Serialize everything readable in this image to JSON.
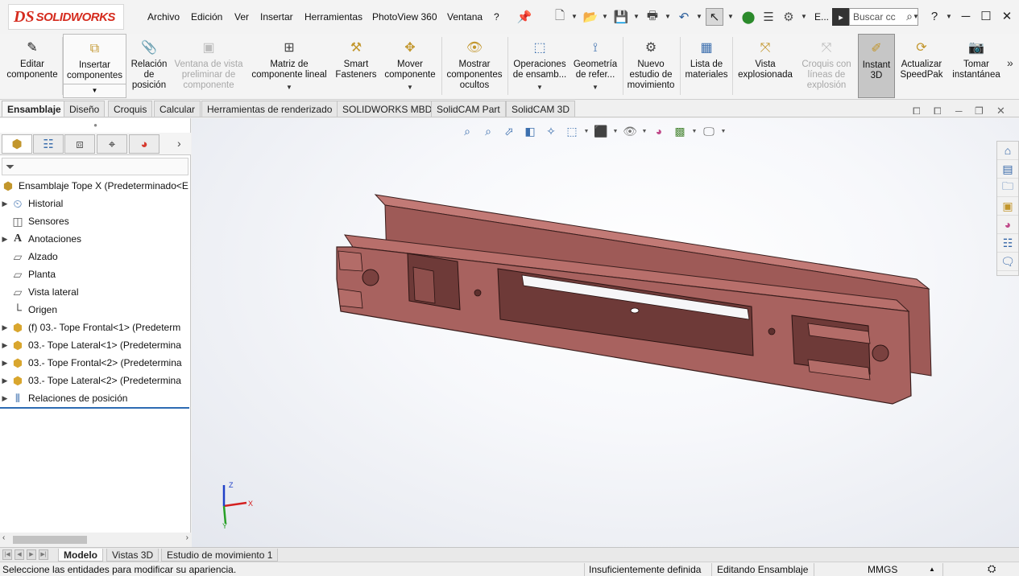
{
  "app": {
    "logo_ds": "DS",
    "logo_text": "SOLIDWORKS",
    "search_placeholder": "Buscar cc",
    "toolbar_more": "E..."
  },
  "menu": [
    "Archivo",
    "Edición",
    "Ver",
    "Insertar",
    "Herramientas",
    "PhotoView 360",
    "Ventana",
    "?"
  ],
  "commands": [
    {
      "label": "Editar\ncomponente",
      "icon": "edit-component-icon",
      "enabled": false
    },
    {
      "label": "Insertar\ncomponentes",
      "icon": "insert-components-icon",
      "enabled": true
    },
    {
      "label": "Relación\nde\nposición",
      "icon": "mate-icon",
      "enabled": true
    },
    {
      "label": "Ventana de vista\npreliminar de\ncomponente",
      "icon": "preview-window-icon",
      "enabled": false
    },
    {
      "label": "Matriz de\ncomponente lineal",
      "icon": "linear-pattern-icon",
      "enabled": true
    },
    {
      "label": "Smart\nFasteners",
      "icon": "smart-fasteners-icon",
      "enabled": true
    },
    {
      "label": "Mover\ncomponente",
      "icon": "move-component-icon",
      "enabled": true
    },
    {
      "label": "Mostrar\ncomponentes\nocultos",
      "icon": "show-hidden-icon",
      "enabled": true
    },
    {
      "label": "Operaciones\nde ensamb...",
      "icon": "assembly-features-icon",
      "enabled": true
    },
    {
      "label": "Geometría\nde refer...",
      "icon": "reference-geometry-icon",
      "enabled": true
    },
    {
      "label": "Nuevo\nestudio de\nmovimiento",
      "icon": "motion-study-icon",
      "enabled": true
    },
    {
      "label": "Lista de\nmateriales",
      "icon": "bom-icon",
      "enabled": true
    },
    {
      "label": "Vista\nexplosionada",
      "icon": "exploded-view-icon",
      "enabled": true
    },
    {
      "label": "Croquis con\nlíneas de\nexplosión",
      "icon": "explode-line-sketch-icon",
      "enabled": false
    },
    {
      "label": "Instant\n3D",
      "icon": "instant3d-icon",
      "enabled": true
    },
    {
      "label": "Actualizar\nSpeedPak",
      "icon": "speedpak-icon",
      "enabled": true
    },
    {
      "label": "Tomar\ninstantánea",
      "icon": "snapshot-icon",
      "enabled": true
    }
  ],
  "tabs": [
    "Ensamblaje",
    "Diseño",
    "Croquis",
    "Calcular",
    "Herramientas de renderizado",
    "SOLIDWORKS MBD",
    "SolidCAM Part",
    "SolidCAM 3D"
  ],
  "tree": [
    {
      "label": "Ensamblaje Tope X  (Predeterminado<E",
      "icon": "assembly-icon",
      "arrow": ""
    },
    {
      "label": "Historial",
      "icon": "history-icon",
      "arrow": "▶"
    },
    {
      "label": "Sensores",
      "icon": "sensors-icon",
      "arrow": ""
    },
    {
      "label": "Anotaciones",
      "icon": "annotations-icon",
      "arrow": "▶"
    },
    {
      "label": "Alzado",
      "icon": "plane-icon",
      "arrow": ""
    },
    {
      "label": "Planta",
      "icon": "plane-icon",
      "arrow": ""
    },
    {
      "label": "Vista lateral",
      "icon": "plane-icon",
      "arrow": ""
    },
    {
      "label": "Origen",
      "icon": "origin-icon",
      "arrow": ""
    },
    {
      "label": "(f) 03.- Tope Frontal<1> (Predeterm",
      "icon": "part-icon",
      "arrow": "▶"
    },
    {
      "label": "03.- Tope Lateral<1> (Predetermina",
      "icon": "part-icon",
      "arrow": "▶"
    },
    {
      "label": "03.- Tope Frontal<2> (Predetermina",
      "icon": "part-icon",
      "arrow": "▶"
    },
    {
      "label": "03.- Tope Lateral<2> (Predetermina",
      "icon": "part-icon",
      "arrow": "▶"
    },
    {
      "label": "Relaciones de posición",
      "icon": "mates-folder-icon",
      "arrow": "▶"
    }
  ],
  "bottom_tabs": [
    "Modelo",
    "Vistas 3D",
    "Estudio de movimiento 1"
  ],
  "status": {
    "message": "Seleccione las entidades para modificar su apariencia.",
    "definition": "Insuficientemente definida",
    "mode": "Editando Ensamblaje",
    "units": "MMGS"
  },
  "triad": {
    "x": "X",
    "y": "Y",
    "z": "Z"
  },
  "colors": {
    "part": "#a8625f",
    "part_dark": "#6e3a38",
    "accent": "#2d6bb3",
    "logo": "#d52b1e"
  }
}
